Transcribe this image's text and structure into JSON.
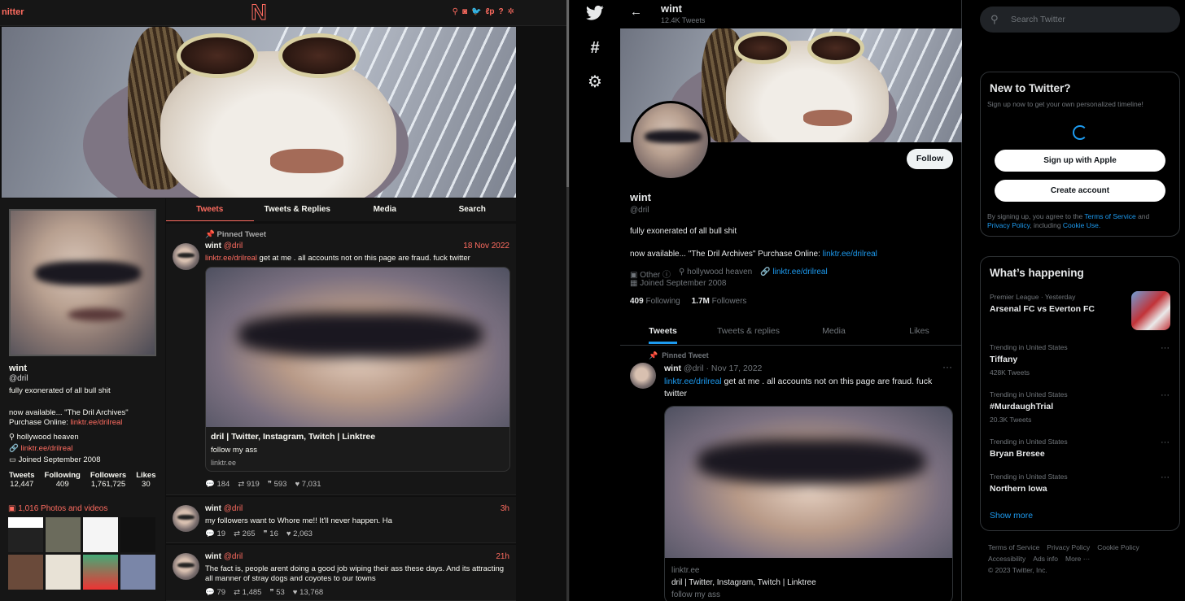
{
  "nitter": {
    "brand": "nitter",
    "logo_letter": "N",
    "nav_icons": [
      "search-icon",
      "rss-icon",
      "twitter-icon",
      "liberapay-icon",
      "help-icon",
      "settings-icon"
    ],
    "nav_glyphs": [
      "⚲",
      "◙",
      "🐦",
      "ℓp",
      "?",
      "✲"
    ],
    "profile": {
      "name": "wint",
      "handle": "@dril",
      "bio": "fully exonerated of all bull shit",
      "bio_line1": "now available... \"The Dril Archives\"",
      "bio_line2_prefix": "Purchase Online: ",
      "bio_link": "linktr.ee/drilreal",
      "location": "hollywood heaven",
      "website": "linktr.ee/drilreal",
      "joined": "Joined September 2008"
    },
    "stats": [
      {
        "label": "Tweets",
        "value": "12,447"
      },
      {
        "label": "Following",
        "value": "409"
      },
      {
        "label": "Followers",
        "value": "1,761,725"
      },
      {
        "label": "Likes",
        "value": "30"
      }
    ],
    "photos_label": "1,016 Photos and videos",
    "tabs": [
      "Tweets",
      "Tweets & Replies",
      "Media",
      "Search"
    ],
    "tweets": [
      {
        "pinned_label": "Pinned Tweet",
        "name": "wint",
        "handle": "@dril",
        "date": "18 Nov 2022",
        "link": "linktr.ee/drilreal",
        "text": " get at me . all accounts not on this page are fraud. fuck twitter",
        "card_title": "dril | Twitter, Instagram, Twitch | Linktree",
        "card_desc": "follow my ass",
        "card_domain": "linktr.ee",
        "replies": "184",
        "retweets": "919",
        "quotes": "593",
        "likes": "7,031"
      },
      {
        "name": "wint",
        "handle": "@dril",
        "date": "3h",
        "text": "my followers want to Whore me!! It'll never happen. Ha",
        "replies": "19",
        "retweets": "265",
        "quotes": "16",
        "likes": "2,063"
      },
      {
        "name": "wint",
        "handle": "@dril",
        "date": "21h",
        "text": "The fact is, people arent doing a good job wiping their ass these days. And its attracting all manner of stray dogs and coyotes to our towns",
        "replies": "79",
        "retweets": "1,485",
        "quotes": "53",
        "likes": "13,768"
      }
    ]
  },
  "twitter": {
    "header": {
      "title": "wint",
      "tweet_count": "12.4K Tweets"
    },
    "follow_label": "Follow",
    "profile": {
      "name": "wint",
      "handle": "@dril",
      "bio": "fully exonerated of all bull shit",
      "bio2_prefix": "now available... \"The Dril Archives\" Purchase Online: ",
      "bio2_link": "linktr.ee/drilreal",
      "category": "Other",
      "location": "hollywood heaven",
      "website": "linktr.ee/drilreal",
      "joined": "Joined September 2008",
      "following": "409",
      "following_label": "Following",
      "followers": "1.7M",
      "followers_label": "Followers"
    },
    "tabs": [
      "Tweets",
      "Tweets & replies",
      "Media",
      "Likes"
    ],
    "tweet": {
      "pinned_label": "Pinned Tweet",
      "name": "wint",
      "meta": "@dril · Nov 17, 2022",
      "link": "linktr.ee/drilreal",
      "text": " get at me . all accounts not on this page are fraud. fuck twitter",
      "card_domain": "linktr.ee",
      "card_title": "dril | Twitter, Instagram, Twitch | Linktree",
      "card_desc": "follow my ass"
    },
    "search_placeholder": "Search Twitter",
    "new_to_twitter": {
      "title": "New to Twitter?",
      "subtitle": "Sign up now to get your own personalized timeline!",
      "apple_label": "Sign up with Apple",
      "create_label": "Create account",
      "legal_prefix": "By signing up, you agree to the ",
      "terms": "Terms of Service",
      "and": " and ",
      "privacy": "Privacy Policy",
      "including": ", including ",
      "cookie": "Cookie Use."
    },
    "whats_happening": {
      "title": "What’s happening",
      "trends": [
        {
          "context": "Premier League · Yesterday",
          "name": "Arsenal FC vs Everton FC",
          "count": ""
        },
        {
          "context": "Trending in United States",
          "name": "Tiffany",
          "count": "428K Tweets"
        },
        {
          "context": "Trending in United States",
          "name": "#MurdaughTrial",
          "count": "20.3K Tweets"
        },
        {
          "context": "Trending in United States",
          "name": "Bryan Bresee",
          "count": ""
        },
        {
          "context": "Trending in United States",
          "name": "Northern Iowa",
          "count": ""
        }
      ],
      "show_more": "Show more"
    },
    "footer": {
      "links": [
        "Terms of Service",
        "Privacy Policy",
        "Cookie Policy",
        "Accessibility",
        "Ads info",
        "More ···"
      ],
      "copyright": "© 2023 Twitter, Inc."
    },
    "accent": "#1d9bf0"
  }
}
